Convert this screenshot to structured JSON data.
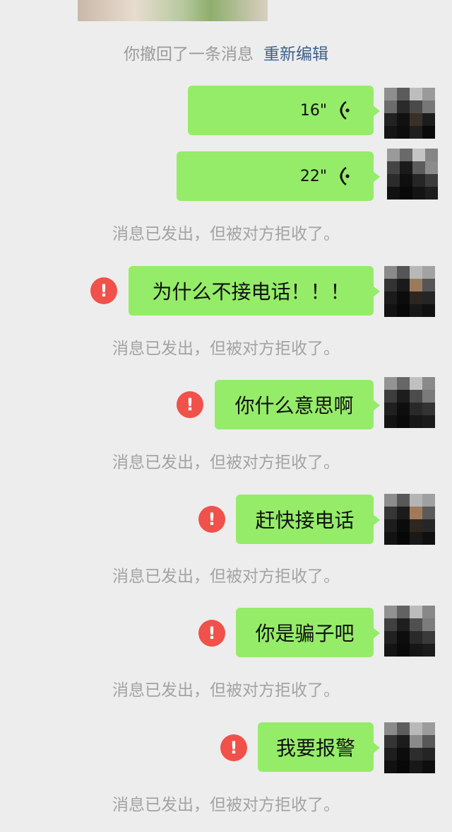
{
  "recall": {
    "text": "你撤回了一条消息",
    "link": "重新编辑"
  },
  "voice_messages": [
    {
      "duration": "16\""
    },
    {
      "duration": "22\""
    }
  ],
  "status_text": "消息已发出，但被对方拒收了。",
  "text_messages": [
    {
      "text": "为什么不接电话！！！",
      "failed": true
    },
    {
      "text": "你什么意思啊",
      "failed": true
    },
    {
      "text": "赶快接电话",
      "failed": true
    },
    {
      "text": "你是骗子吧",
      "failed": true
    },
    {
      "text": "我要报警",
      "failed": true
    }
  ],
  "error_icon_glyph": "!",
  "colors": {
    "background": "#ededed",
    "bubble": "#95ec69",
    "error": "#f0514b",
    "link": "#3e5f8c",
    "status": "#a3a3a3"
  }
}
